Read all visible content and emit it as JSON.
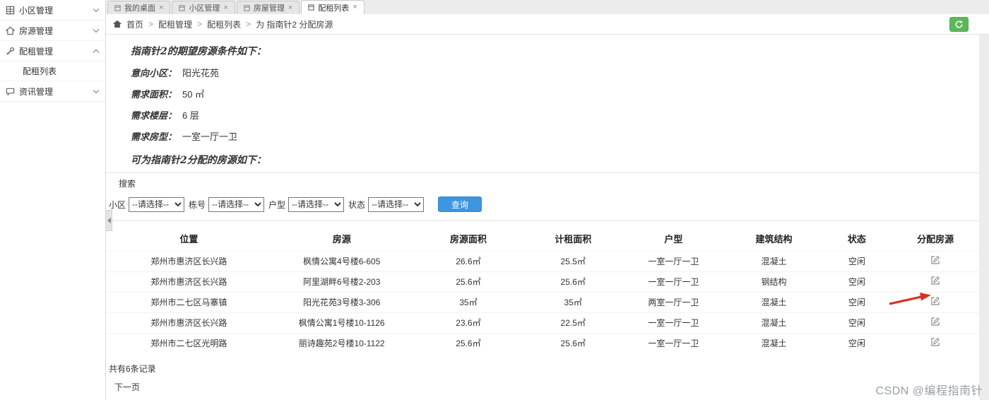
{
  "icons": {
    "close": "×"
  },
  "colors": {
    "primary_button": "#3e95e0",
    "refresh_button": "#5cb85c",
    "annotation_arrow": "#d93025"
  },
  "sidebar": {
    "items": [
      {
        "label": "小区管理"
      },
      {
        "label": "房源管理"
      },
      {
        "label": "配租管理"
      },
      {
        "label": "资讯管理"
      }
    ],
    "sub_item": "配租列表"
  },
  "tabs": {
    "items": [
      {
        "label": "我的桌面"
      },
      {
        "label": "小区管理"
      },
      {
        "label": "房屋管理"
      },
      {
        "label": "配租列表"
      }
    ]
  },
  "breadcrumb": {
    "home": "首页",
    "items": [
      "配租管理",
      "配租列表",
      "为 指南针2 分配房源"
    ]
  },
  "page": {
    "title": "指南针2的期望房源条件如下：",
    "conditions": [
      {
        "label": "意向小区：",
        "value": "阳光花苑"
      },
      {
        "label": "需求面积：",
        "value": "50 ㎡"
      },
      {
        "label": "需求楼层：",
        "value": "6 层"
      },
      {
        "label": "需求房型：",
        "value": "一室一厅一卫"
      }
    ],
    "subtitle": "可为指南针2分配的房源如下："
  },
  "search": {
    "panel_label": "搜索",
    "filters": [
      {
        "label": "小区",
        "selected": "--请选择--"
      },
      {
        "label": "栋号",
        "selected": "--请选择--"
      },
      {
        "label": "户型",
        "selected": "--请选择--"
      },
      {
        "label": "状态",
        "selected": "--请选择--"
      }
    ],
    "query_button": "查询"
  },
  "table": {
    "headers": [
      "位置",
      "房源",
      "房源面积",
      "计租面积",
      "户型",
      "建筑结构",
      "状态",
      "分配房源"
    ],
    "rows": [
      [
        "郑州市惠济区长兴路",
        "枫情公寓4号楼6-605",
        "26.6㎡",
        "25.5㎡",
        "一室一厅一卫",
        "混凝土",
        "空闲"
      ],
      [
        "郑州市惠济区长兴路",
        "阿里湖畔6号楼2-203",
        "25.6㎡",
        "25.6㎡",
        "一室一厅一卫",
        "钢结构",
        "空闲"
      ],
      [
        "郑州市二七区马寨镇",
        "阳光花苑3号楼3-306",
        "35㎡",
        "35㎡",
        "两室一厅一卫",
        "混凝土",
        "空闲"
      ],
      [
        "郑州市惠济区长兴路",
        "枫情公寓1号楼10-1126",
        "23.6㎡",
        "22.5㎡",
        "一室一厅一卫",
        "混凝土",
        "空闲"
      ],
      [
        "郑州市二七区光明路",
        "丽诗趣苑2号楼10-1122",
        "25.6㎡",
        "25.6㎡",
        "一室一厅一卫",
        "混凝土",
        "空闲"
      ]
    ]
  },
  "footer": {
    "record_count": "共有6条记录",
    "next_page": "下一页"
  },
  "watermark": "CSDN @编程指南针"
}
